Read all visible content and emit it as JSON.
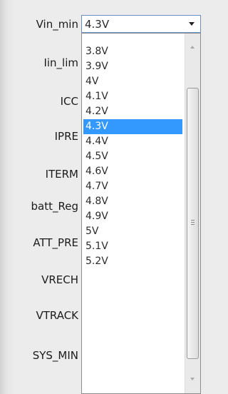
{
  "labels": [
    "Vin_min",
    "Iin_lim",
    "ICC",
    "IPRE",
    "ITERM",
    "batt_Reg",
    "ATT_PRE",
    "VRECH",
    "VTRACK",
    "SYS_MIN"
  ],
  "combo": {
    "value": "4.3V"
  },
  "dropdown": {
    "options": [
      "3.8V",
      "3.9V",
      "4V",
      "4.1V",
      "4.2V",
      "4.3V",
      "4.4V",
      "4.5V",
      "4.6V",
      "4.7V",
      "4.8V",
      "4.9V",
      "5V",
      "5.1V",
      "5.2V"
    ],
    "selected": "4.3V"
  },
  "colors": {
    "selection": "#3399ff",
    "combo_border": "#6a8fc5"
  },
  "icons": {
    "combo_arrow": "chevron-down-icon",
    "scroll_up": "scroll-up-icon",
    "scroll_down": "scroll-down-icon"
  }
}
